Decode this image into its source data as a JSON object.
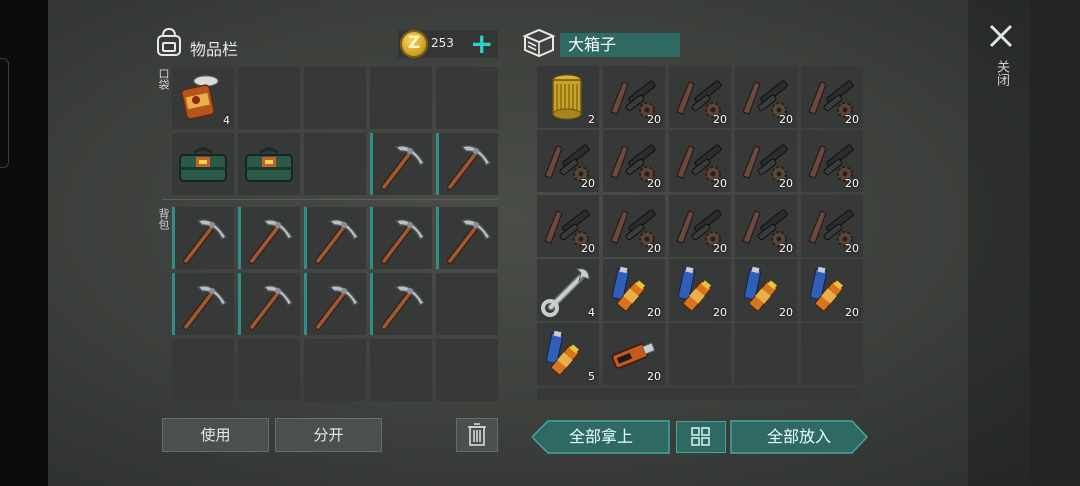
{
  "inventory": {
    "title": "物品栏",
    "pocket_label": "口袋",
    "backpack_label": "背包",
    "coins": "253",
    "add_symbol": "+"
  },
  "chest": {
    "title": "大箱子"
  },
  "close": {
    "label": "关闭"
  },
  "buttons": {
    "use": "使用",
    "split": "分开",
    "take_all": "全部拿上",
    "put_all": "全部放入"
  },
  "pocket_slots": [
    {
      "item": "canned-food",
      "qty": "4"
    },
    {
      "item": "empty"
    },
    {
      "item": "empty"
    },
    {
      "item": "empty"
    },
    {
      "item": "empty"
    },
    {
      "item": "toolbox"
    },
    {
      "item": "toolbox"
    },
    {
      "item": "empty"
    },
    {
      "item": "pickaxe"
    },
    {
      "item": "pickaxe"
    }
  ],
  "backpack_slots": [
    {
      "item": "pickaxe"
    },
    {
      "item": "pickaxe"
    },
    {
      "item": "pickaxe"
    },
    {
      "item": "pickaxe"
    },
    {
      "item": "pickaxe"
    },
    {
      "item": "pickaxe"
    },
    {
      "item": "pickaxe"
    },
    {
      "item": "pickaxe"
    },
    {
      "item": "pickaxe"
    },
    {
      "item": "empty"
    },
    {
      "item": "empty"
    },
    {
      "item": "empty"
    },
    {
      "item": "empty"
    },
    {
      "item": "empty"
    },
    {
      "item": "empty"
    }
  ],
  "chest_slots": [
    {
      "item": "oil-filter",
      "qty": "2"
    },
    {
      "item": "gun-parts",
      "qty": "20"
    },
    {
      "item": "gun-parts",
      "qty": "20"
    },
    {
      "item": "gun-parts",
      "qty": "20"
    },
    {
      "item": "gun-parts",
      "qty": "20"
    },
    {
      "item": "gun-parts",
      "qty": "20"
    },
    {
      "item": "gun-parts",
      "qty": "20"
    },
    {
      "item": "gun-parts",
      "qty": "20"
    },
    {
      "item": "gun-parts",
      "qty": "20"
    },
    {
      "item": "gun-parts",
      "qty": "20"
    },
    {
      "item": "gun-parts",
      "qty": "20"
    },
    {
      "item": "gun-parts",
      "qty": "20"
    },
    {
      "item": "gun-parts",
      "qty": "20"
    },
    {
      "item": "gun-parts",
      "qty": "20"
    },
    {
      "item": "gun-parts",
      "qty": "20"
    },
    {
      "item": "wrench",
      "qty": "4"
    },
    {
      "item": "batteries",
      "qty": "20"
    },
    {
      "item": "batteries",
      "qty": "20"
    },
    {
      "item": "batteries",
      "qty": "20"
    },
    {
      "item": "batteries",
      "qty": "20"
    },
    {
      "item": "batteries",
      "qty": "5"
    },
    {
      "item": "usb-drive",
      "qty": "20"
    },
    {
      "item": "empty"
    },
    {
      "item": "empty"
    },
    {
      "item": "empty"
    }
  ],
  "icons": {
    "backpack": "backpack-icon",
    "coin": "coin-icon",
    "chest": "chest-icon",
    "close": "close-icon",
    "trash": "trash-icon",
    "grid": "grid-icon"
  },
  "colors": {
    "accent_teal": "#2fd0c6",
    "button_teal": "#2e6964",
    "slot_bg": "#363937"
  }
}
